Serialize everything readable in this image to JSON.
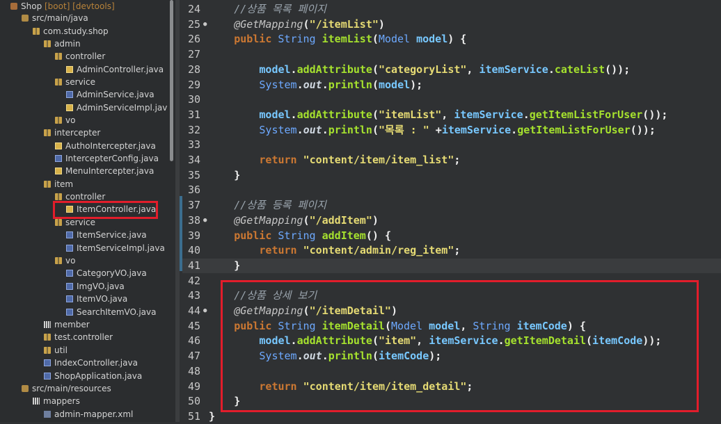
{
  "explorer": {
    "rows": [
      {
        "label": "Shop",
        "extra": "[boot] [devtools]",
        "depth": 0,
        "arrow": "⌄",
        "icon": "proj"
      },
      {
        "label": "src/main/java",
        "depth": 1,
        "arrow": "⌄",
        "icon": "srcf"
      },
      {
        "label": "com.study.shop",
        "depth": 2,
        "arrow": "⌄",
        "icon": "pkg"
      },
      {
        "label": "admin",
        "depth": 3,
        "arrow": "⌄",
        "icon": "pkg"
      },
      {
        "label": "controller",
        "depth": 4,
        "arrow": "⌄",
        "icon": "pkg"
      },
      {
        "label": "AdminController.java",
        "depth": 5,
        "arrow": "›",
        "icon": "java-ann"
      },
      {
        "label": "service",
        "depth": 4,
        "arrow": "⌄",
        "icon": "pkg"
      },
      {
        "label": "AdminService.java",
        "depth": 5,
        "arrow": "›",
        "icon": "java"
      },
      {
        "label": "AdminServiceImpl.java",
        "depth": 5,
        "arrow": "›",
        "icon": "java-ann"
      },
      {
        "label": "vo",
        "depth": 4,
        "arrow": "›",
        "icon": "pkg"
      },
      {
        "label": "intercepter",
        "depth": 3,
        "arrow": "⌄",
        "icon": "pkg"
      },
      {
        "label": "AuthoIntercepter.java",
        "depth": 4,
        "arrow": "›",
        "icon": "java-ann"
      },
      {
        "label": "IntercepterConfig.java",
        "depth": 4,
        "arrow": "›",
        "icon": "java"
      },
      {
        "label": "MenuIntercepter.java",
        "depth": 4,
        "arrow": "›",
        "icon": "java-ann"
      },
      {
        "label": "item",
        "depth": 3,
        "arrow": "⌄",
        "icon": "pkg"
      },
      {
        "label": "controller",
        "depth": 4,
        "arrow": "⌄",
        "icon": "pkg"
      },
      {
        "label": "ItemController.java",
        "depth": 5,
        "arrow": "›",
        "icon": "java-ann"
      },
      {
        "label": "service",
        "depth": 4,
        "arrow": "⌄",
        "icon": "pkg"
      },
      {
        "label": "ItemService.java",
        "depth": 5,
        "arrow": "›",
        "icon": "java"
      },
      {
        "label": "ItemServiceImpl.java",
        "depth": 5,
        "arrow": "›",
        "icon": "java"
      },
      {
        "label": "vo",
        "depth": 4,
        "arrow": "⌄",
        "icon": "pkg"
      },
      {
        "label": "CategoryVO.java",
        "depth": 5,
        "arrow": "›",
        "icon": "java"
      },
      {
        "label": "ImgVO.java",
        "depth": 5,
        "arrow": "›",
        "icon": "java"
      },
      {
        "label": "ItemVO.java",
        "depth": 5,
        "arrow": "›",
        "icon": "java"
      },
      {
        "label": "SearchItemVO.java",
        "depth": 5,
        "arrow": "›",
        "icon": "java"
      },
      {
        "label": "member",
        "depth": 3,
        "arrow": "›",
        "icon": "grid"
      },
      {
        "label": "test.controller",
        "depth": 3,
        "arrow": "›",
        "icon": "pkg"
      },
      {
        "label": "util",
        "depth": 3,
        "arrow": "›",
        "icon": "pkg"
      },
      {
        "label": "IndexController.java",
        "depth": 3,
        "arrow": "›",
        "icon": "java"
      },
      {
        "label": "ShopApplication.java",
        "depth": 3,
        "arrow": "›",
        "icon": "java"
      },
      {
        "label": "src/main/resources",
        "depth": 1,
        "arrow": "⌄",
        "icon": "srcf"
      },
      {
        "label": "mappers",
        "depth": 2,
        "arrow": "⌄",
        "icon": "grid"
      },
      {
        "label": "admin-mapper.xml",
        "depth": 3,
        "arrow": "",
        "icon": "xml"
      }
    ]
  },
  "editor": {
    "lines": [
      {
        "n": "24",
        "tokens": [
          [
            "cm",
            "//상품 목록 페이지"
          ]
        ],
        "indent": 4
      },
      {
        "n": "25",
        "fold": true,
        "tokens": [
          [
            "an",
            "@GetMapping"
          ],
          [
            "pl",
            "("
          ],
          [
            "st",
            "\"/itemList\""
          ],
          [
            "pl",
            ")"
          ]
        ],
        "indent": 4
      },
      {
        "n": "26",
        "tokens": [
          [
            "kw",
            "public "
          ],
          [
            "ty",
            "String "
          ],
          [
            "fn",
            "itemList"
          ],
          [
            "pl",
            "("
          ],
          [
            "ty",
            "Model "
          ],
          [
            "id",
            "model"
          ],
          [
            "pl",
            ") {"
          ]
        ],
        "indent": 4
      },
      {
        "n": "27",
        "tokens": [],
        "indent": 0
      },
      {
        "n": "28",
        "tokens": [
          [
            "id",
            "model"
          ],
          [
            "pl",
            "."
          ],
          [
            "fn",
            "addAttribute"
          ],
          [
            "pl",
            "("
          ],
          [
            "st",
            "\"categoryList\""
          ],
          [
            "pl",
            ", "
          ],
          [
            "id",
            "itemService"
          ],
          [
            "pl",
            "."
          ],
          [
            "fn",
            "cateList"
          ],
          [
            "pl",
            "());"
          ]
        ],
        "indent": 8
      },
      {
        "n": "29",
        "tokens": [
          [
            "ty",
            "System"
          ],
          [
            "pl",
            "."
          ],
          [
            "fld",
            "out"
          ],
          [
            "pl",
            "."
          ],
          [
            "fn",
            "println"
          ],
          [
            "pl",
            "("
          ],
          [
            "id",
            "model"
          ],
          [
            "pl",
            ");"
          ]
        ],
        "indent": 8
      },
      {
        "n": "30",
        "tokens": [],
        "indent": 0
      },
      {
        "n": "31",
        "tokens": [
          [
            "id",
            "model"
          ],
          [
            "pl",
            "."
          ],
          [
            "fn",
            "addAttribute"
          ],
          [
            "pl",
            "("
          ],
          [
            "st",
            "\"itemList\""
          ],
          [
            "pl",
            ", "
          ],
          [
            "id",
            "itemService"
          ],
          [
            "pl",
            "."
          ],
          [
            "fn",
            "getItemListForUser"
          ],
          [
            "pl",
            "());"
          ]
        ],
        "indent": 8
      },
      {
        "n": "32",
        "tokens": [
          [
            "ty",
            "System"
          ],
          [
            "pl",
            "."
          ],
          [
            "fld",
            "out"
          ],
          [
            "pl",
            "."
          ],
          [
            "fn",
            "println"
          ],
          [
            "pl",
            "("
          ],
          [
            "st",
            "\"목록 : \""
          ],
          [
            "pl",
            " +"
          ],
          [
            "id",
            "itemService"
          ],
          [
            "pl",
            "."
          ],
          [
            "fn",
            "getItemListForUser"
          ],
          [
            "pl",
            "());"
          ]
        ],
        "indent": 8
      },
      {
        "n": "33",
        "tokens": [],
        "indent": 0
      },
      {
        "n": "34",
        "tokens": [
          [
            "kw",
            "return "
          ],
          [
            "st",
            "\"content/item/item_list\""
          ],
          [
            "pl",
            ";"
          ]
        ],
        "indent": 8
      },
      {
        "n": "35",
        "tokens": [
          [
            "pl",
            "}"
          ]
        ],
        "indent": 4
      },
      {
        "n": "36",
        "tokens": [],
        "indent": 0
      },
      {
        "n": "37",
        "tokens": [
          [
            "cm",
            "//상품 등록 페이지"
          ]
        ],
        "indent": 4
      },
      {
        "n": "38",
        "fold": true,
        "tokens": [
          [
            "an",
            "@GetMapping"
          ],
          [
            "pl",
            "("
          ],
          [
            "st",
            "\"/addItem\""
          ],
          [
            "pl",
            ")"
          ]
        ],
        "indent": 4
      },
      {
        "n": "39",
        "tokens": [
          [
            "kw",
            "public "
          ],
          [
            "ty",
            "String "
          ],
          [
            "fn",
            "addItem"
          ],
          [
            "pl",
            "() "
          ],
          [
            "pl",
            "{"
          ]
        ],
        "indent": 4
      },
      {
        "n": "40",
        "tokens": [
          [
            "kw",
            "return "
          ],
          [
            "st",
            "\"content/admin/reg_item\""
          ],
          [
            "pl",
            ";"
          ]
        ],
        "indent": 8
      },
      {
        "n": "41",
        "current": true,
        "tokens": [
          [
            "pl",
            "}"
          ]
        ],
        "indent": 4
      },
      {
        "n": "42",
        "tokens": [],
        "indent": 0
      },
      {
        "n": "43",
        "tokens": [
          [
            "cm",
            "//상품 상세 보기"
          ]
        ],
        "indent": 4
      },
      {
        "n": "44",
        "fold": true,
        "tokens": [
          [
            "an",
            "@GetMapping"
          ],
          [
            "pl",
            "("
          ],
          [
            "st",
            "\"/itemDetail\""
          ],
          [
            "pl",
            ")"
          ]
        ],
        "indent": 4
      },
      {
        "n": "45",
        "tokens": [
          [
            "kw",
            "public "
          ],
          [
            "ty",
            "String "
          ],
          [
            "fn",
            "itemDetail"
          ],
          [
            "pl",
            "("
          ],
          [
            "ty",
            "Model "
          ],
          [
            "id",
            "model"
          ],
          [
            "pl",
            ", "
          ],
          [
            "ty",
            "String "
          ],
          [
            "id",
            "itemCode"
          ],
          [
            "pl",
            ") {"
          ]
        ],
        "indent": 4
      },
      {
        "n": "46",
        "tokens": [
          [
            "id",
            "model"
          ],
          [
            "pl",
            "."
          ],
          [
            "fn",
            "addAttribute"
          ],
          [
            "pl",
            "("
          ],
          [
            "st",
            "\"item\""
          ],
          [
            "pl",
            ", "
          ],
          [
            "id",
            "itemService"
          ],
          [
            "pl",
            "."
          ],
          [
            "fn",
            "getItemDetail"
          ],
          [
            "pl",
            "("
          ],
          [
            "id",
            "itemCode"
          ],
          [
            "pl",
            "));"
          ]
        ],
        "indent": 8
      },
      {
        "n": "47",
        "tokens": [
          [
            "ty",
            "System"
          ],
          [
            "pl",
            "."
          ],
          [
            "fld",
            "out"
          ],
          [
            "pl",
            "."
          ],
          [
            "fn",
            "println"
          ],
          [
            "pl",
            "("
          ],
          [
            "id",
            "itemCode"
          ],
          [
            "pl",
            ");"
          ]
        ],
        "indent": 8
      },
      {
        "n": "48",
        "tokens": [],
        "indent": 0
      },
      {
        "n": "49",
        "tokens": [
          [
            "kw",
            "return "
          ],
          [
            "st",
            "\"content/item/item_detail\""
          ],
          [
            "pl",
            ";"
          ]
        ],
        "indent": 8
      },
      {
        "n": "50",
        "tokens": [
          [
            "pl",
            "}"
          ]
        ],
        "indent": 4
      },
      {
        "n": "51",
        "tokens": [
          [
            "pl",
            "}"
          ]
        ],
        "indent": 0
      }
    ]
  }
}
